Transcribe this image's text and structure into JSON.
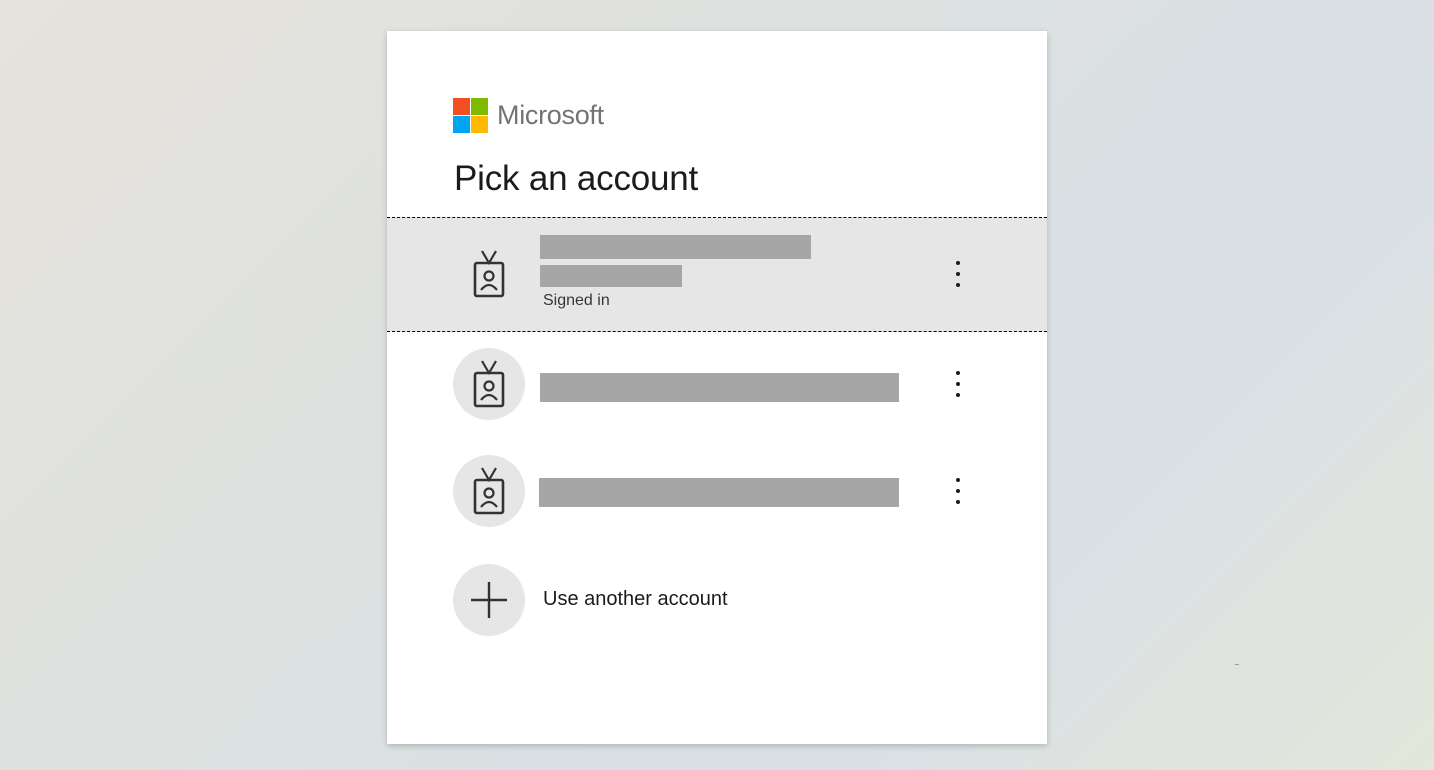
{
  "brand": {
    "name": "Microsoft",
    "colors": {
      "red": "#f25022",
      "green": "#7fba00",
      "blue": "#00a4ef",
      "yellow": "#ffb900"
    }
  },
  "title": "Pick an account",
  "accounts": [
    {
      "name": "[redacted]",
      "email": "[redacted]",
      "status": "Signed in",
      "icon": "badge-icon",
      "selected": true
    },
    {
      "email": "[redacted]",
      "icon": "badge-icon",
      "selected": false
    },
    {
      "email": "[redacted]",
      "icon": "badge-icon",
      "selected": false
    }
  ],
  "other_account": {
    "label": "Use another account",
    "icon": "plus-icon"
  },
  "more_options_icon": "more-vertical-icon"
}
